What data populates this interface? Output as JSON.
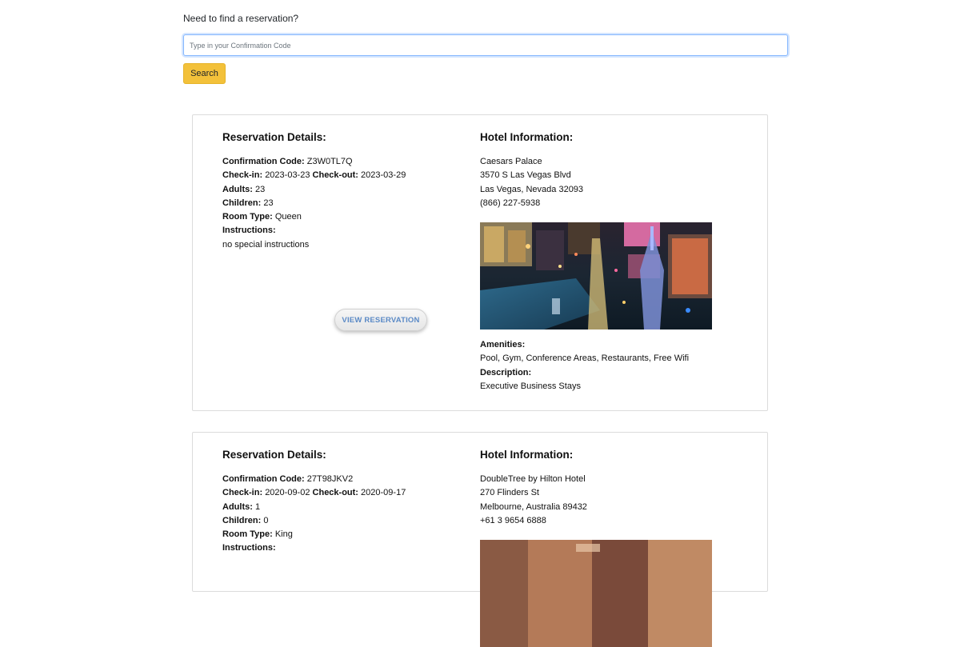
{
  "search": {
    "label": "Need to find a reservation?",
    "placeholder": "Type in your Confirmation Code",
    "button_label": "Search"
  },
  "labels": {
    "reservation_details": "Reservation Details:",
    "hotel_information": "Hotel Information:",
    "confirmation_code": "Confirmation Code:",
    "check_in": "Check-in:",
    "check_out": "Check-out:",
    "adults": "Adults:",
    "children": "Children:",
    "room_type": "Room Type:",
    "instructions": "Instructions:",
    "amenities": "Amenities:",
    "description": "Description:",
    "view_reservation": "VIEW RESERVATION"
  },
  "reservations": [
    {
      "confirmation_code": "Z3W0TL7Q",
      "check_in": "2023-03-23",
      "check_out": "2023-03-29",
      "adults": "23",
      "children": "23",
      "room_type": "Queen",
      "instructions": "no special instructions",
      "hotel": {
        "name": "Caesars Palace",
        "street": "3570 S Las Vegas Blvd",
        "city_line": "Las Vegas, Nevada 32093",
        "phone": "(866) 227-5938",
        "amenities": "Pool, Gym, Conference Areas, Restaurants, Free Wifi",
        "description": "Executive Business Stays"
      }
    },
    {
      "confirmation_code": "27T98JKV2",
      "check_in": "2020-09-02",
      "check_out": "2020-09-17",
      "adults": "1",
      "children": "0",
      "room_type": "King",
      "hotel": {
        "name": "DoubleTree by Hilton Hotel",
        "street": "270 Flinders St",
        "city_line": "Melbourne, Australia 89432",
        "phone": "+61 3 9654 6888"
      }
    }
  ]
}
